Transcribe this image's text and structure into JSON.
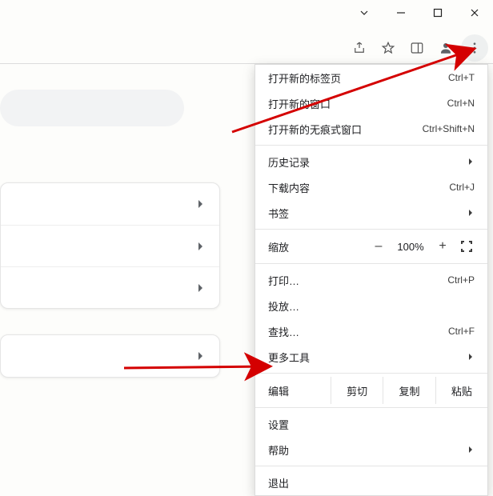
{
  "window_controls": {
    "chevron": "⌄",
    "min": "–",
    "max": "☐",
    "close": "✕"
  },
  "toolbar": {
    "share": "share-icon",
    "star": "star-icon",
    "panel": "panel-icon",
    "profile": "profile-icon",
    "menu": "kebab-menu-icon"
  },
  "menu": {
    "new_tab": {
      "label": "打开新的标签页",
      "shortcut": "Ctrl+T"
    },
    "new_window": {
      "label": "打开新的窗口",
      "shortcut": "Ctrl+N"
    },
    "new_incognito": {
      "label": "打开新的无痕式窗口",
      "shortcut": "Ctrl+Shift+N"
    },
    "history": {
      "label": "历史记录"
    },
    "downloads": {
      "label": "下载内容",
      "shortcut": "Ctrl+J"
    },
    "bookmarks": {
      "label": "书签"
    },
    "zoom": {
      "label": "缩放",
      "minus": "–",
      "value": "100%",
      "plus": "+"
    },
    "print": {
      "label": "打印…",
      "shortcut": "Ctrl+P"
    },
    "cast": {
      "label": "投放…"
    },
    "find": {
      "label": "查找…",
      "shortcut": "Ctrl+F"
    },
    "more_tools": {
      "label": "更多工具"
    },
    "edit": {
      "label": "编辑",
      "cut": "剪切",
      "copy": "复制",
      "paste": "粘贴"
    },
    "settings": {
      "label": "设置"
    },
    "help": {
      "label": "帮助"
    },
    "exit": {
      "label": "退出"
    }
  }
}
